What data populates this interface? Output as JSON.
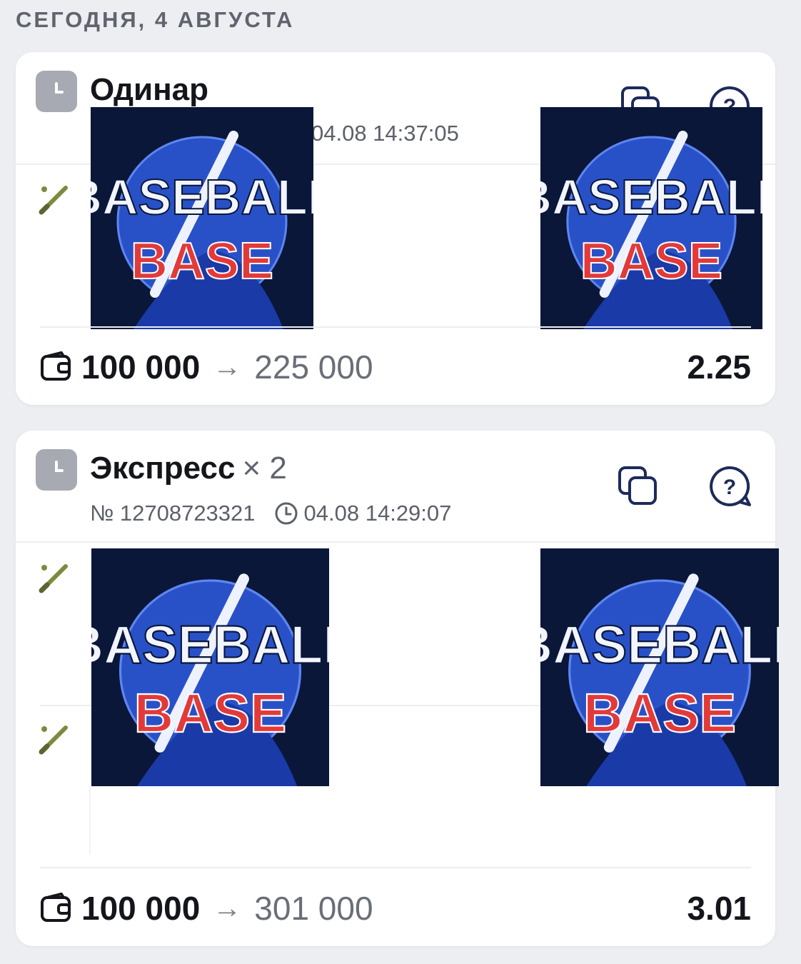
{
  "date_header": "СЕГОДНЯ, 4 АВГУСТА",
  "colors": {
    "background": "#edeef2",
    "card": "#ffffff",
    "badge": "#a7aab3",
    "icon_navy": "#1e2a5a",
    "logo_bg": "#0a1739",
    "logo_blue": "#2f5ce0",
    "logo_red": "#e23a3a"
  },
  "bets": [
    {
      "status_icon": "clock-icon",
      "title": "Одинар",
      "multiplier": "",
      "number": "",
      "time": "04.08 14:37:05",
      "event_icons": [
        "baseball-bat-icon"
      ],
      "stake": "100 000",
      "arrow": "→",
      "potential_win": "225 000",
      "coefficient": "2.25"
    },
    {
      "status_icon": "clock-icon",
      "title": "Экспресс",
      "multiplier": "× 2",
      "number": "№ 12708723321",
      "time": "04.08 14:29:07",
      "event_icons": [
        "baseball-bat-icon",
        "baseball-bat-icon"
      ],
      "stake": "100 000",
      "arrow": "→",
      "potential_win": "301 000",
      "coefficient": "3.01"
    }
  ],
  "logo": {
    "line1": "BASEBALL",
    "line2": "BASE"
  }
}
